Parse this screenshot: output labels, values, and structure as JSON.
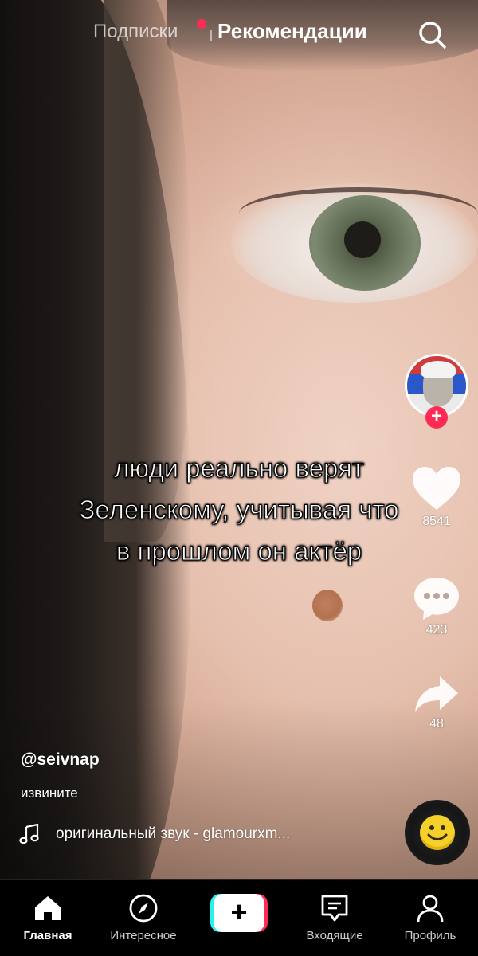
{
  "top_tabs": {
    "following": "Подписки",
    "for_you": "Рекомендации"
  },
  "video": {
    "overlay_lines": [
      "люди реально верят",
      "Зеленскому, учитывая что",
      "в прошлом он актёр"
    ],
    "author": "@seivnap",
    "description": "извините",
    "sound": "оригинальный звук - glamourxm..."
  },
  "actions": {
    "likes": "8541",
    "comments": "423",
    "shares": "48"
  },
  "nav": {
    "home": "Главная",
    "discover": "Интересное",
    "create": "+",
    "inbox": "Входящие",
    "profile": "Профиль"
  },
  "colors": {
    "accent": "#fe2c55",
    "cyan": "#25f4ee",
    "background": "#000000"
  },
  "icons": [
    "search-icon",
    "like-icon",
    "comment-icon",
    "share-icon",
    "music-note-icon",
    "home-icon",
    "compass-icon",
    "inbox-icon",
    "profile-icon"
  ]
}
